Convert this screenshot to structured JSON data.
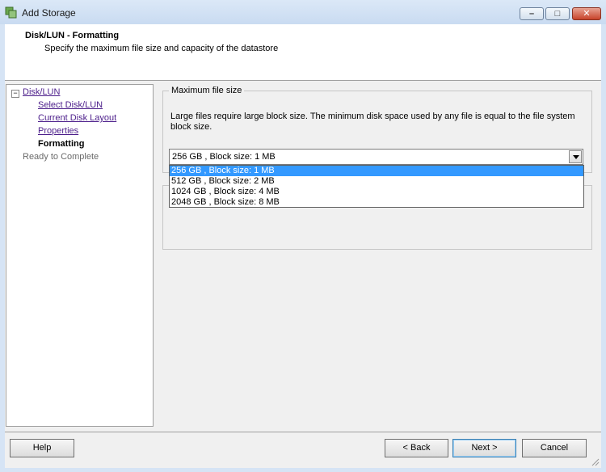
{
  "window": {
    "title": "Add Storage"
  },
  "header": {
    "title": "Disk/LUN - Formatting",
    "subtitle": "Specify the maximum file size and capacity of the datastore"
  },
  "nav": {
    "tree_toggle": "−",
    "root": "Disk/LUN",
    "items": [
      {
        "label": "Select Disk/LUN",
        "state": "link"
      },
      {
        "label": "Current Disk Layout",
        "state": "link"
      },
      {
        "label": "Properties",
        "state": "link"
      },
      {
        "label": "Formatting",
        "state": "current"
      }
    ],
    "last": "Ready to Complete"
  },
  "max_file_size": {
    "group_title": "Maximum file size",
    "description": "Large files require large block size.  The minimum disk space used by any file is equal to the file system block size.",
    "selected": "256 GB  ,  Block size: 1 MB",
    "options": [
      "256 GB  ,  Block size: 1 MB",
      "512 GB  ,  Block size: 2 MB",
      "1024 GB  ,  Block size: 4 MB",
      "2048 GB  ,  Block size: 8 MB"
    ]
  },
  "buttons": {
    "help": "Help",
    "back": "< Back",
    "next": "Next >",
    "cancel": "Cancel"
  },
  "colors": {
    "selection": "#3399ff",
    "link": "#4b1d8a",
    "title_bar": "#c9dbf1"
  }
}
